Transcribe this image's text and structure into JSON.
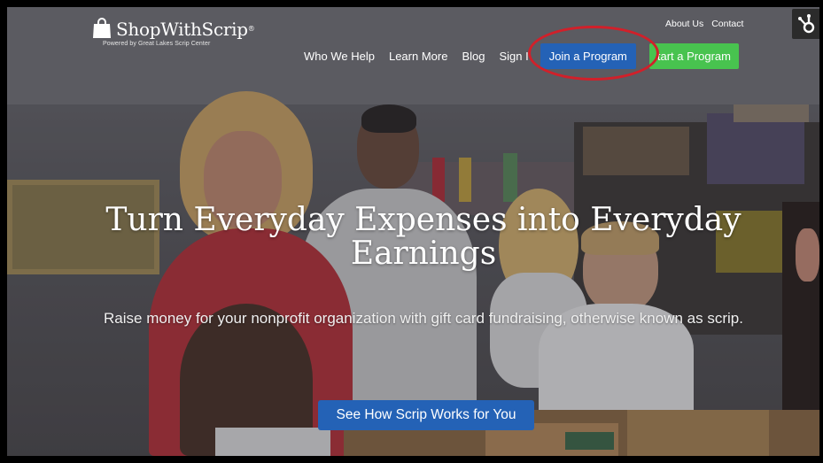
{
  "logo": {
    "name": "ShopWithScrip",
    "trademark": "®",
    "tagline": "Powered by Great Lakes Scrip Center"
  },
  "top_nav": {
    "about": "About Us",
    "contact": "Contact"
  },
  "main_nav": {
    "items": [
      "Who We Help",
      "Learn More",
      "Blog",
      "Sign I"
    ],
    "join_button": "Join a Program",
    "start_button": "tart a Program"
  },
  "hero": {
    "title": "Turn Everyday Expenses into Everyday Earnings",
    "subtitle": "Raise money for your nonprofit organization with gift card fundraising, otherwise known as scrip.",
    "cta": "See How Scrip Works for You"
  },
  "colors": {
    "primary_blue": "#2462b6",
    "start_green": "#48c34f",
    "highlight_red": "#d1202a"
  },
  "icons": {
    "logo": "shopping-bag-icon",
    "widget": "hubspot-sprocket-icon"
  }
}
